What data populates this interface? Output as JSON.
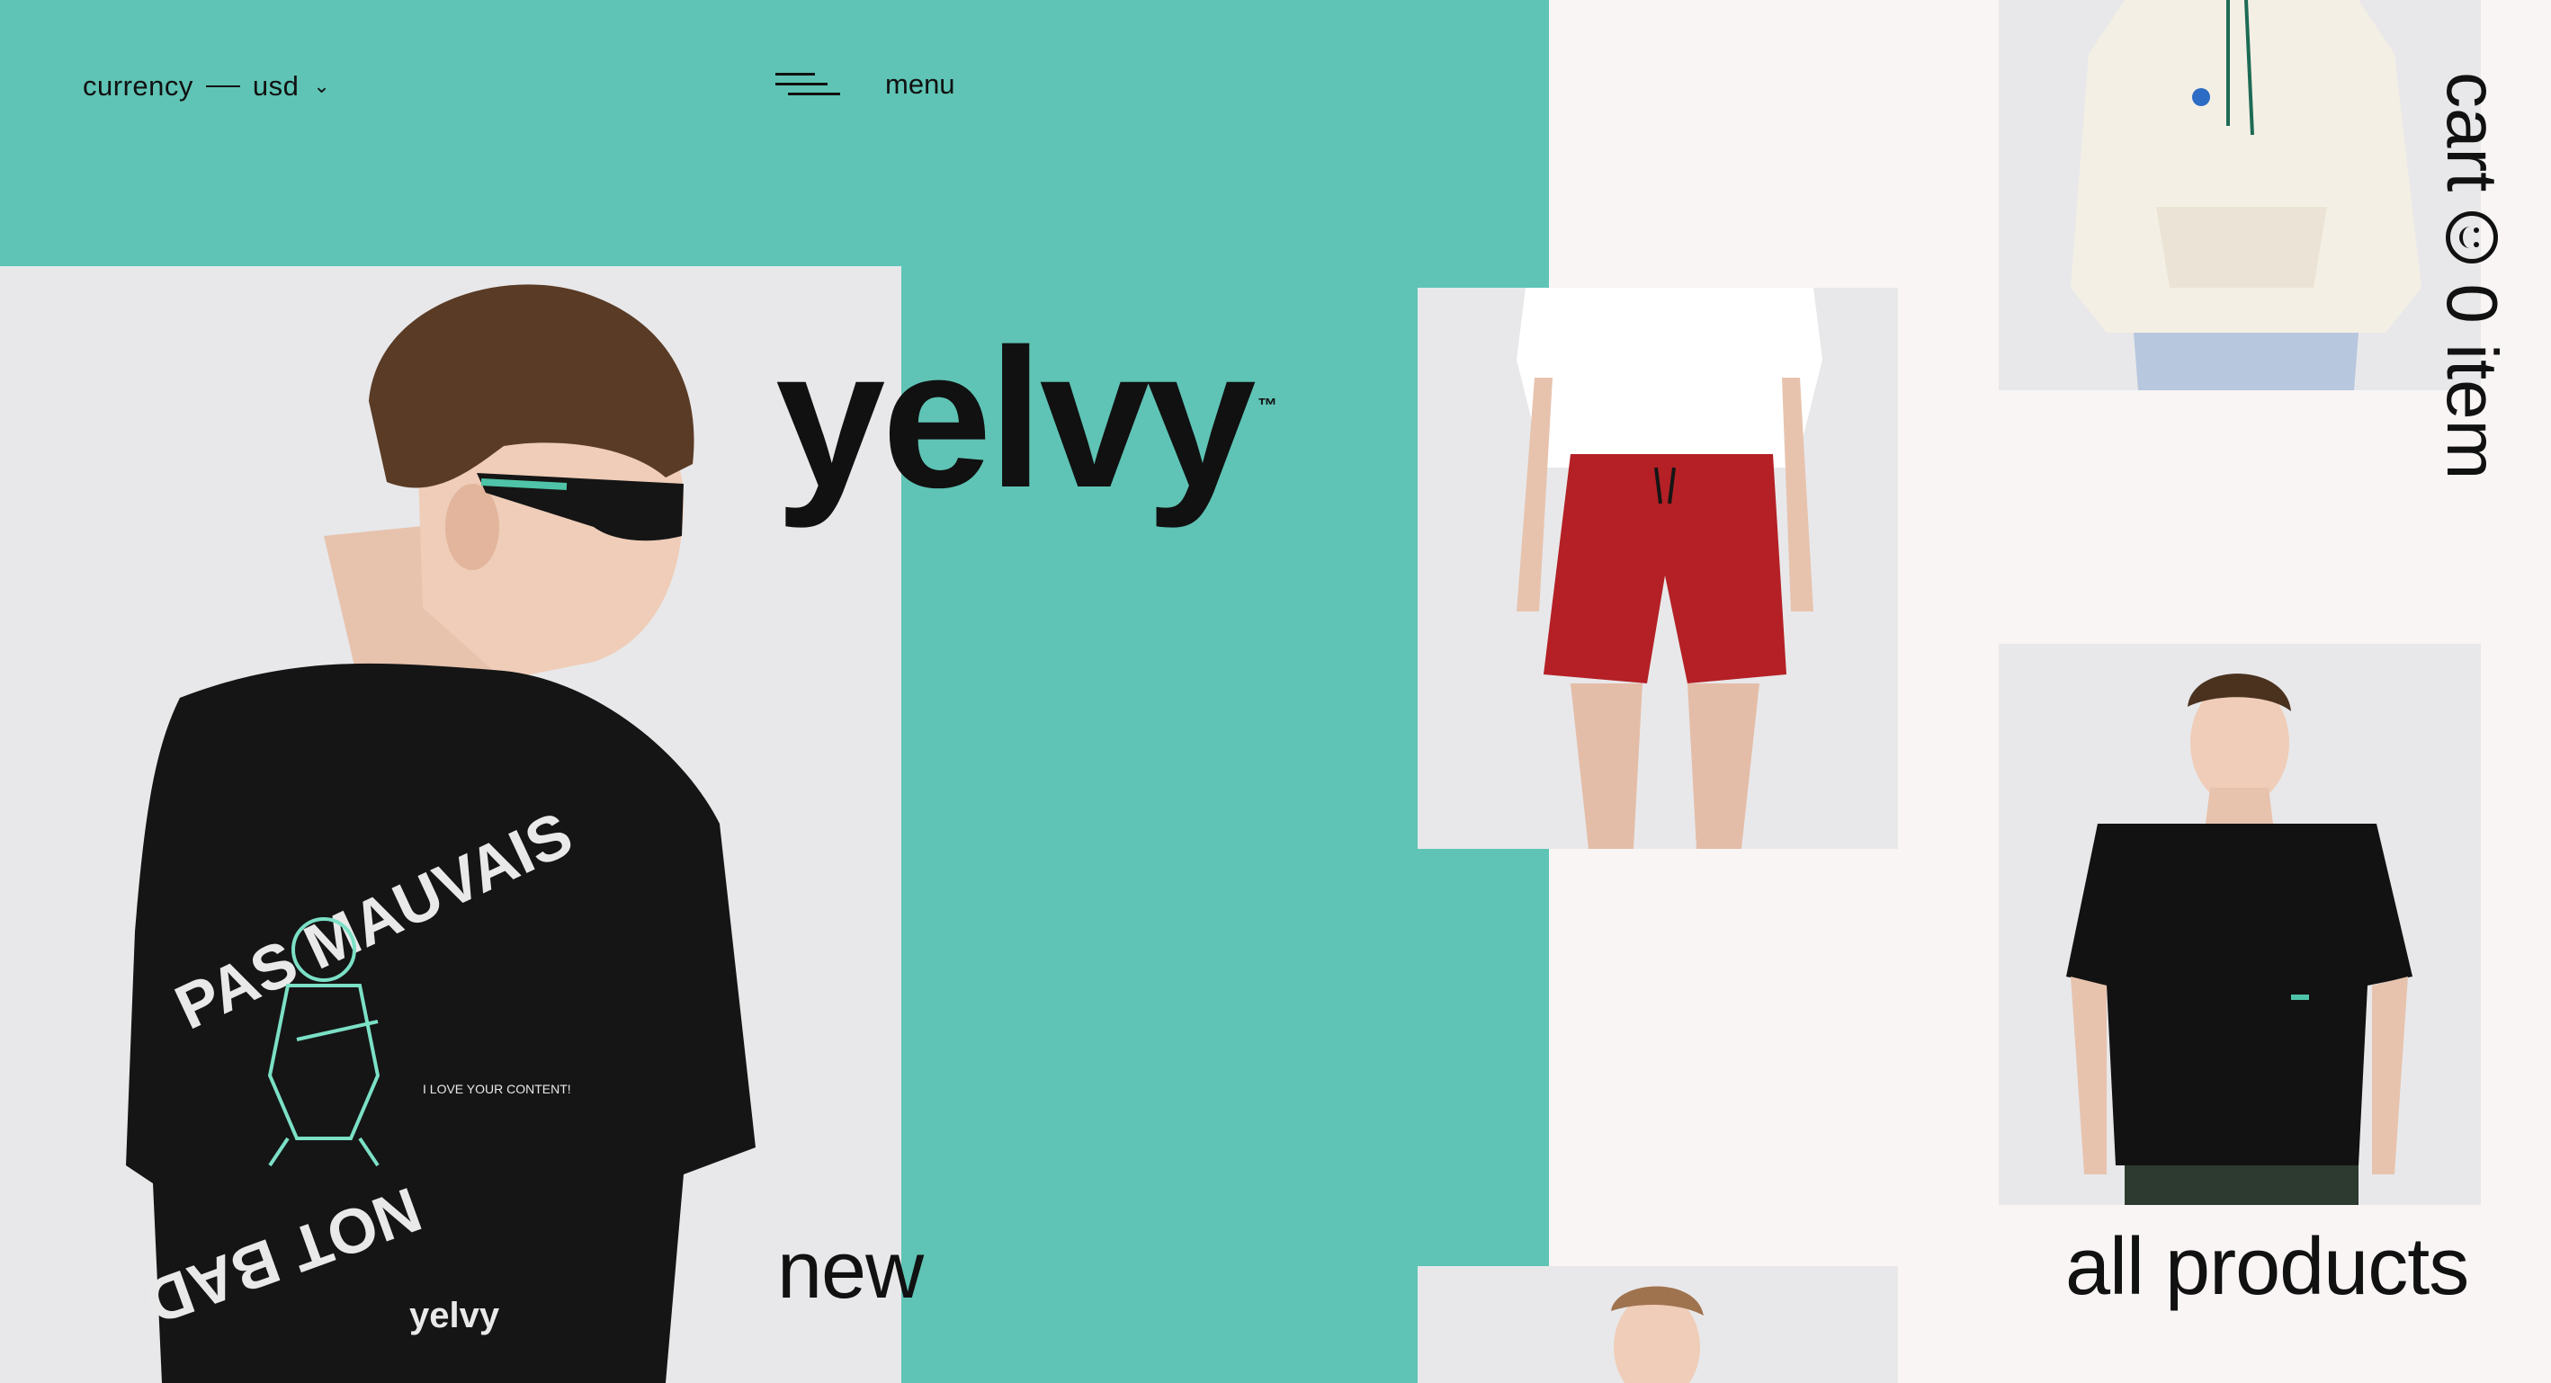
{
  "header": {
    "currency_label": "currency",
    "currency_value": "usd",
    "menu_label": "menu"
  },
  "brand": {
    "logo": "yelvy",
    "trademark": "™"
  },
  "hero": {
    "print_top": "PAS MAUVAIS",
    "print_bottom": "NOT BAD",
    "print_side": "I LOVE YOUR CONTENT!",
    "shirt_logo": "yelvy"
  },
  "links": {
    "new": "new",
    "all_products": "all products"
  },
  "cart": {
    "label": "cart",
    "count": "0 item"
  },
  "colors": {
    "accent": "#5fc4b5",
    "background": "#f8f5f4",
    "tile": "#e8e8ea",
    "text": "#111111"
  }
}
